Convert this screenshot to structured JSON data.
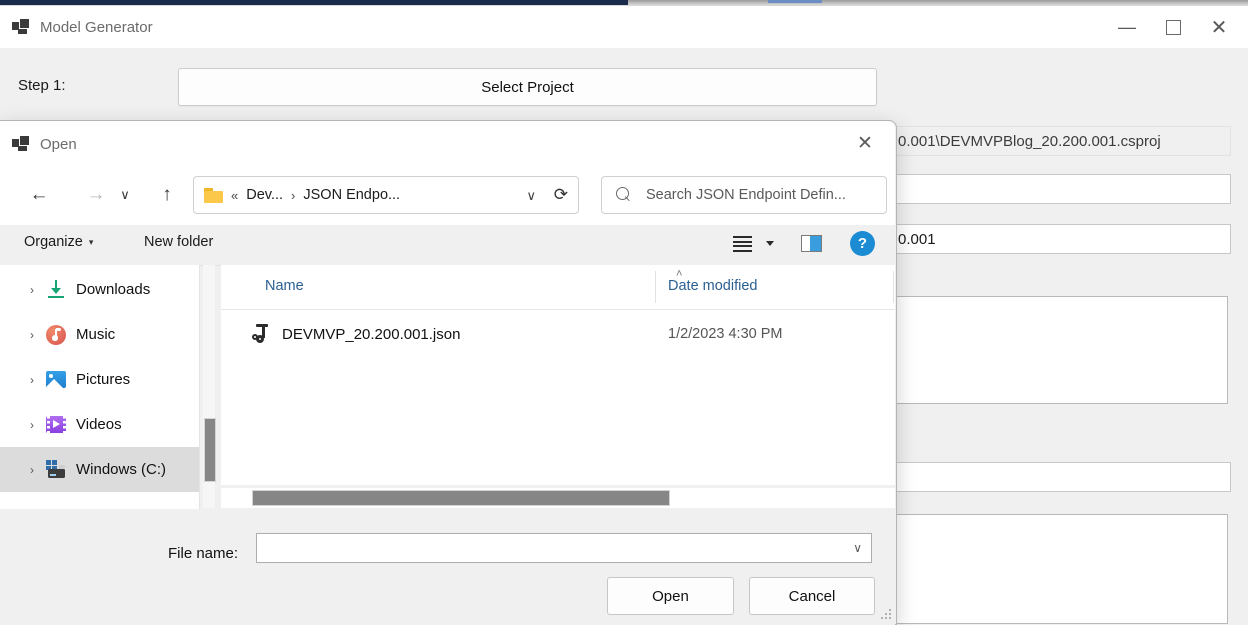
{
  "app_window": {
    "title": "Model Generator",
    "icon": "app-squares-icon",
    "controls": {
      "minimize": "—",
      "maximize": "",
      "close": "✕"
    },
    "step": {
      "label": "Step 1:",
      "button": "Select Project"
    },
    "background_fields": [
      {
        "value": "0.001\\DEVMVPBlog_20.200.001.csproj"
      },
      {
        "value": ""
      },
      {
        "value": "0.001"
      }
    ]
  },
  "dialog": {
    "title": "Open",
    "icon": "app-squares-icon",
    "close": "✕",
    "nav": {
      "back": "←",
      "forward": "→",
      "recent": "∨",
      "up": "↑",
      "breadcrumb": {
        "folder_icon": "folder-icon",
        "overflow": "«",
        "crumb1": "Dev...",
        "separator": "›",
        "crumb2": "JSON Endpo...",
        "dropdown": "∨",
        "refresh": "⟳"
      },
      "search_placeholder": "Search JSON Endpoint Defin..."
    },
    "toolbar": {
      "organize": "Organize",
      "organize_caret": "▾",
      "new_folder": "New folder",
      "view_icon": "list-view-icon",
      "view_caret": "chevron-down-icon",
      "preview_pane_icon": "preview-pane-icon",
      "help_icon": "?"
    },
    "nav_pane": {
      "items": [
        {
          "label": "Downloads",
          "icon": "downloads-icon",
          "chevron": "›",
          "selected": false
        },
        {
          "label": "Music",
          "icon": "music-icon",
          "chevron": "›",
          "selected": false
        },
        {
          "label": "Pictures",
          "icon": "pictures-icon",
          "chevron": "›",
          "selected": false
        },
        {
          "label": "Videos",
          "icon": "videos-icon",
          "chevron": "›",
          "selected": false
        },
        {
          "label": "Windows (C:)",
          "icon": "drive-icon",
          "chevron": "›",
          "selected": true
        }
      ]
    },
    "file_list": {
      "columns": {
        "name": "Name",
        "date_modified": "Date modified",
        "sort_caret": "˄"
      },
      "rows": [
        {
          "icon": "json-file-icon",
          "name": "DEVMVP_20.200.001.json",
          "date_modified": "1/2/2023 4:30 PM"
        }
      ]
    },
    "footer": {
      "file_name_label": "File name:",
      "file_name_value": "",
      "file_name_chevron": "∨",
      "open_button": "Open",
      "cancel_button": "Cancel"
    }
  },
  "colors": {
    "accent_blue": "#1b8bd4",
    "column_header_text": "#2a5f91",
    "selection": "#dcdcdc",
    "navy_strip": "#1b2b4b",
    "folder_yellow": "#fbc84a"
  }
}
